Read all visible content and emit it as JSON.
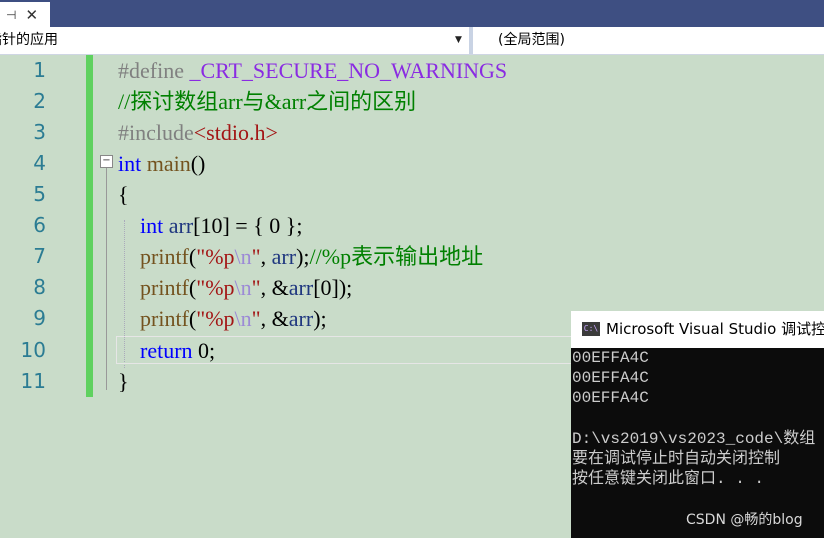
{
  "tab": {
    "pin": "⊣",
    "close": "✕"
  },
  "nav": {
    "scope": "指针的应用",
    "global": "(全局范围)"
  },
  "editor": {
    "lines": [
      {
        "num": "1",
        "pp": "#define ",
        "macro": "_CRT_SECURE_NO_WARNINGS"
      },
      {
        "num": "2",
        "comment": "//探讨数组arr与&arr之间的区别"
      },
      {
        "num": "3",
        "pp": "#include",
        "header": "<stdio.h>"
      },
      {
        "num": "4",
        "kw": "int",
        "fn": " main",
        "rest": "()"
      },
      {
        "num": "5",
        "text": "{"
      },
      {
        "num": "6",
        "indent": "    ",
        "kw": "int",
        "var": " arr",
        "rest": "[10] = { 0 };"
      },
      {
        "num": "7",
        "indent": "    ",
        "fn": "printf",
        "p1": "(",
        "s1": "\"%p",
        "esc": "\\n",
        "s2": "\"",
        "p2": ", ",
        "var": "arr",
        "p3": ");",
        "comment": "//%p表示输出地址"
      },
      {
        "num": "8",
        "indent": "    ",
        "fn": "printf",
        "p1": "(",
        "s1": "\"%p",
        "esc": "\\n",
        "s2": "\"",
        "p2": ", &",
        "var": "arr",
        "p3": "[0]);"
      },
      {
        "num": "9",
        "indent": "    ",
        "fn": "printf",
        "p1": "(",
        "s1": "\"%p",
        "esc": "\\n",
        "s2": "\"",
        "p2": ", &",
        "var": "arr",
        "p3": ");"
      },
      {
        "num": "10",
        "indent": "    ",
        "kw": "return",
        "rest": " 0;"
      },
      {
        "num": "11",
        "text": "}"
      }
    ]
  },
  "console": {
    "icon": "C:\\",
    "title": "Microsoft Visual Studio 调试控",
    "lines": [
      "00EFFA4C",
      "00EFFA4C",
      "00EFFA4C",
      "",
      "D:\\vs2019\\vs2023_code\\数组",
      "要在调试停止时自动关闭控制",
      "按任意键关闭此窗口. . ."
    ]
  },
  "watermark": "CSDN @畅的blog"
}
